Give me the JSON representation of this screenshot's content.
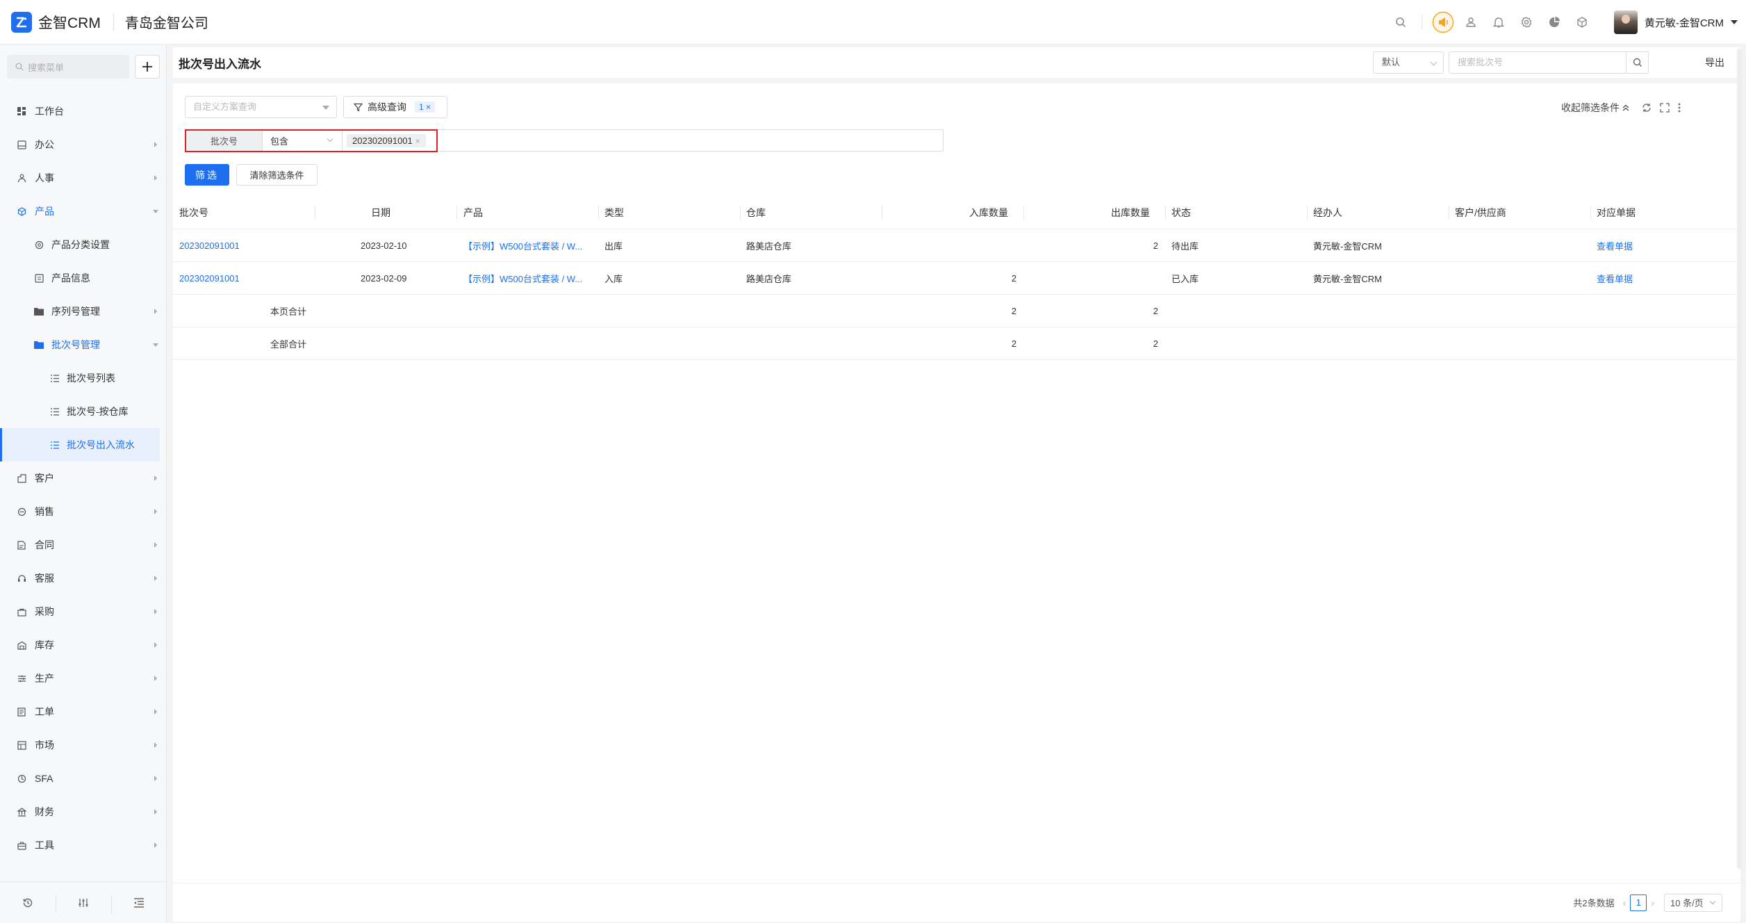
{
  "app": {
    "name": "金智CRM",
    "company": "青岛金智公司"
  },
  "user": {
    "name": "黄元敏-金智CRM"
  },
  "topbar_icons": [
    "search-icon",
    "announcement-icon",
    "contacts-icon",
    "bell-icon",
    "gear-icon",
    "pie-chart-icon",
    "cube-icon"
  ],
  "sidebar": {
    "search_placeholder": "搜索菜单",
    "items": [
      {
        "label": "工作台",
        "icon": "dashboard-icon"
      },
      {
        "label": "办公",
        "icon": "office-icon"
      },
      {
        "label": "人事",
        "icon": "people-icon"
      },
      {
        "label": "产品",
        "icon": "product-icon"
      },
      {
        "label": "产品分类设置",
        "icon": "category-icon"
      },
      {
        "label": "产品信息",
        "icon": "info-icon"
      },
      {
        "label": "序列号管理",
        "icon": "folder-icon"
      },
      {
        "label": "批次号管理",
        "icon": "folder-icon"
      },
      {
        "label": "批次号列表",
        "icon": "list-icon"
      },
      {
        "label": "批次号-按仓库",
        "icon": "list-icon"
      },
      {
        "label": "批次号出入流水",
        "icon": "list-icon"
      },
      {
        "label": "客户",
        "icon": "customer-icon"
      },
      {
        "label": "销售",
        "icon": "sales-icon"
      },
      {
        "label": "合同",
        "icon": "contract-icon"
      },
      {
        "label": "客服",
        "icon": "headset-icon"
      },
      {
        "label": "采购",
        "icon": "purchase-icon"
      },
      {
        "label": "库存",
        "icon": "warehouse-icon"
      },
      {
        "label": "生产",
        "icon": "production-icon"
      },
      {
        "label": "工单",
        "icon": "ticket-icon"
      },
      {
        "label": "市场",
        "icon": "market-icon"
      },
      {
        "label": "SFA",
        "icon": "sfa-icon"
      },
      {
        "label": "财务",
        "icon": "finance-icon"
      },
      {
        "label": "工具",
        "icon": "tools-icon"
      }
    ],
    "bottom_icons": [
      "history-icon",
      "tune-icon",
      "collapse-menu-icon"
    ]
  },
  "page": {
    "title": "批次号出入流水",
    "view_select": "默认",
    "search_placeholder": "搜索批次号",
    "export_label": "导出"
  },
  "filters": {
    "scheme_placeholder": "自定义方案查询",
    "advanced_label": "高级查询",
    "advanced_count": "1",
    "collapse_label": "收起筛选条件",
    "condition": {
      "field": "批次号",
      "operator": "包含",
      "value": "202302091001"
    },
    "filter_button": "筛选",
    "clear_button": "清除筛选条件"
  },
  "table": {
    "columns": [
      "批次号",
      "日期",
      "产品",
      "类型",
      "仓库",
      "入库数量",
      "出库数量",
      "状态",
      "经办人",
      "客户/供应商",
      "对应单据"
    ],
    "rows": [
      {
        "batch": "202302091001",
        "date": "2023-02-10",
        "product": "【示例】W500台式套装 / W...",
        "type": "出库",
        "warehouse": "路美店仓库",
        "in_qty": "",
        "out_qty": "2",
        "status": "待出库",
        "handler": "黄元敏-金智CRM",
        "partner": "",
        "doc": "查看单据"
      },
      {
        "batch": "202302091001",
        "date": "2023-02-09",
        "product": "【示例】W500台式套装 / W...",
        "type": "入库",
        "warehouse": "路美店仓库",
        "in_qty": "2",
        "out_qty": "",
        "status": "已入库",
        "handler": "黄元敏-金智CRM",
        "partner": "",
        "doc": "查看单据"
      }
    ],
    "page_total": {
      "label": "本页合计",
      "in_qty": "2",
      "out_qty": "2"
    },
    "grand_total": {
      "label": "全部合计",
      "in_qty": "2",
      "out_qty": "2"
    }
  },
  "pagination": {
    "total_text": "共2条数据",
    "current_page": "1",
    "page_size": "10 条/页"
  },
  "colors": {
    "primary": "#1e6ff0",
    "highlight_border": "#e02020",
    "notice_badge": "#f5a623"
  }
}
